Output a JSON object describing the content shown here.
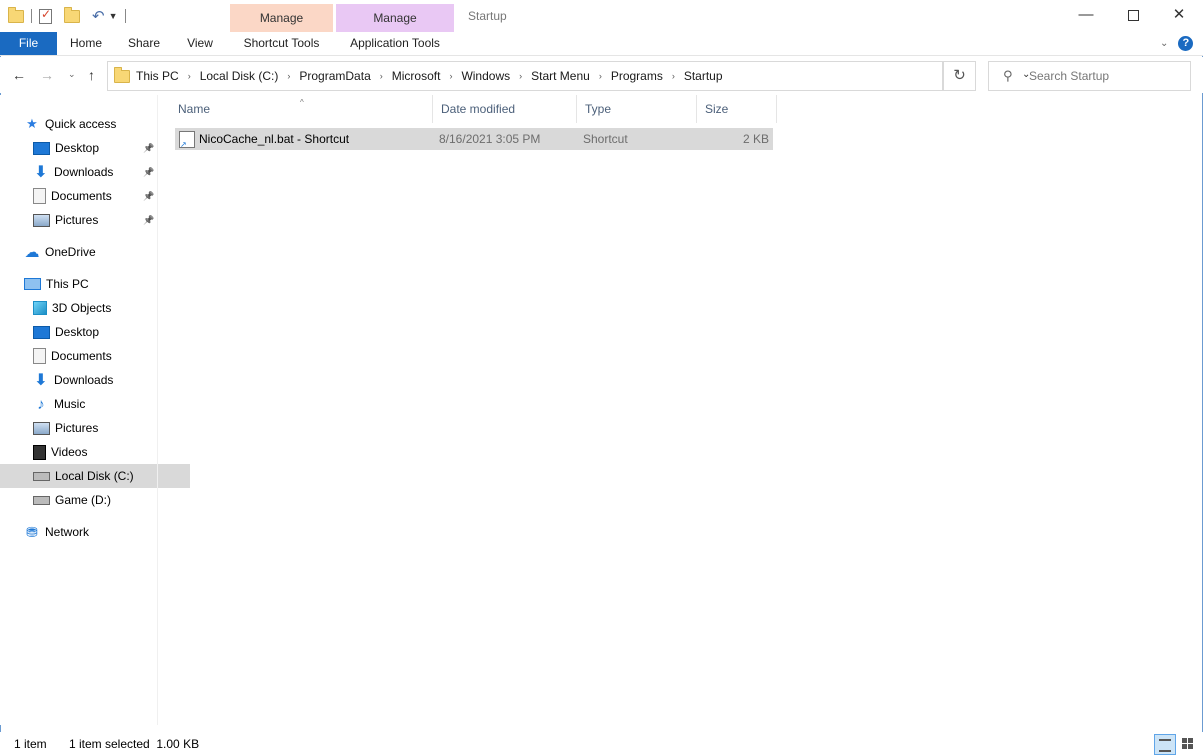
{
  "window": {
    "title": "Startup",
    "contextual_tabs": [
      {
        "group": "Manage",
        "tab": "Shortcut Tools",
        "color": "#fbd7c6"
      },
      {
        "group": "Manage",
        "tab": "Application Tools",
        "color": "#e9c8f4"
      }
    ]
  },
  "ribbon": {
    "tabs": [
      "File",
      "Home",
      "Share",
      "View"
    ],
    "accent": "#1a6ac1"
  },
  "address": {
    "path": [
      "This PC",
      "Local Disk (C:)",
      "ProgramData",
      "Microsoft",
      "Windows",
      "Start Menu",
      "Programs",
      "Startup"
    ]
  },
  "search": {
    "placeholder": "Search Startup"
  },
  "sidebar": {
    "items": [
      {
        "label": "Quick access",
        "icon": "star-icon",
        "level": 0
      },
      {
        "label": "Desktop",
        "icon": "desktop-icon",
        "level": 1,
        "pinned": true
      },
      {
        "label": "Downloads",
        "icon": "download-icon",
        "level": 1,
        "pinned": true
      },
      {
        "label": "Documents",
        "icon": "document-icon",
        "level": 1,
        "pinned": true
      },
      {
        "label": "Pictures",
        "icon": "pictures-icon",
        "level": 1,
        "pinned": true
      },
      {
        "label": "OneDrive",
        "icon": "cloud-icon",
        "level": 0
      },
      {
        "label": "This PC",
        "icon": "computer-icon",
        "level": 0
      },
      {
        "label": "3D Objects",
        "icon": "cube-icon",
        "level": 1
      },
      {
        "label": "Desktop",
        "icon": "desktop-icon",
        "level": 1
      },
      {
        "label": "Documents",
        "icon": "document-icon",
        "level": 1
      },
      {
        "label": "Downloads",
        "icon": "download-icon",
        "level": 1
      },
      {
        "label": "Music",
        "icon": "music-icon",
        "level": 1
      },
      {
        "label": "Pictures",
        "icon": "pictures-icon",
        "level": 1
      },
      {
        "label": "Videos",
        "icon": "video-icon",
        "level": 1
      },
      {
        "label": "Local Disk (C:)",
        "icon": "drive-icon",
        "level": 1,
        "selected": true
      },
      {
        "label": "Game (D:)",
        "icon": "drive-icon",
        "level": 1
      },
      {
        "label": "Network",
        "icon": "network-icon",
        "level": 0
      }
    ]
  },
  "file_list": {
    "columns": [
      "Name",
      "Date modified",
      "Type",
      "Size"
    ],
    "rows": [
      {
        "name": "NicoCache_nl.bat - Shortcut",
        "date": "8/16/2021 3:05 PM",
        "type": "Shortcut",
        "size": "2 KB",
        "selected": true
      }
    ]
  },
  "status": {
    "count": "1 item",
    "selection": "1 item selected  1.00 KB"
  }
}
